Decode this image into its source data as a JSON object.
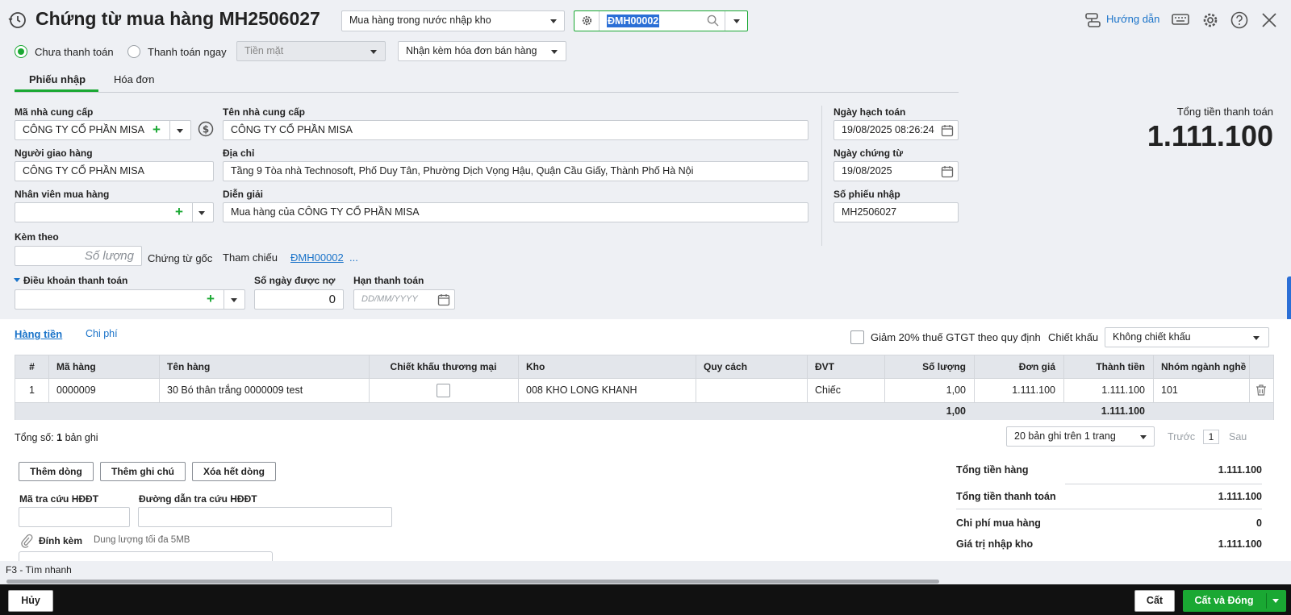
{
  "header": {
    "title": "Chứng từ mua hàng MH2506027",
    "type_select": "Mua hàng trong nước nhập kho",
    "ref_search": "ĐMH00002",
    "guide_label": "Hướng dẫn"
  },
  "payment": {
    "unpaid_label": "Chưa thanh toán",
    "paid_now_label": "Thanh toán ngay",
    "method_select": "Tiền mặt",
    "invoice_select": "Nhận kèm hóa đơn bán hàng"
  },
  "tabs": {
    "receipt": "Phiếu nhập",
    "invoice": "Hóa đơn"
  },
  "form": {
    "supplier_code_label": "Mã nhà cung cấp",
    "supplier_code": "CÔNG TY CỔ PHẦN MISA",
    "supplier_name_label": "Tên nhà cung cấp",
    "supplier_name": "CÔNG TY CỔ PHẦN MISA",
    "deliverer_label": "Người giao hàng",
    "deliverer": "CÔNG TY CỔ PHẦN MISA",
    "address_label": "Địa chỉ",
    "address": "Tầng 9 Tòa nhà Technosoft, Phố Duy Tân, Phường Dịch Vọng Hậu, Quận Cầu Giấy, Thành Phố Hà Nội",
    "buyer_label": "Nhân viên mua hàng",
    "buyer": "",
    "description_label": "Diễn giải",
    "description": "Mua hàng của CÔNG TY CỔ PHẦN MISA",
    "attach_label": "Kèm theo",
    "attach_placeholder": "Số lượng",
    "original_doc": "Chứng từ gốc",
    "reference_label": "Tham chiếu",
    "reference_link": "ĐMH00002",
    "reference_more": "...",
    "terms_label": "Điều khoản thanh toán",
    "credit_days_label": "Số ngày được nợ",
    "credit_days": "0",
    "due_date_label": "Hạn thanh toán",
    "due_date_placeholder": "DD/MM/YYYY",
    "posting_date_label": "Ngày hạch toán",
    "posting_date": "19/08/2025 08:26:24",
    "doc_date_label": "Ngày chứng từ",
    "doc_date": "19/08/2025",
    "receipt_no_label": "Số phiếu nhập",
    "receipt_no": "MH2506027",
    "total_label": "Tổng tiền thanh toán",
    "total": "1.111.100"
  },
  "detail_tabs": {
    "goods": "Hàng tiền",
    "cost": "Chi phí"
  },
  "discount": {
    "vat_reduce_label": "Giảm 20% thuế GTGT theo quy định",
    "label": "Chiết khấu",
    "select": "Không chiết khấu"
  },
  "table": {
    "headers": [
      "#",
      "Mã hàng",
      "Tên hàng",
      "Chiết khấu thương mại",
      "Kho",
      "Quy cách",
      "ĐVT",
      "Số lượng",
      "Đơn giá",
      "Thành tiền",
      "Nhóm ngành nghề"
    ],
    "rows": [
      {
        "no": "1",
        "code": "0000009",
        "name": "30 Bó thân trắng 0000009 test",
        "warehouse": "008 KHO LONG KHANH",
        "spec": "",
        "unit": "Chiếc",
        "qty": "1,00",
        "price": "1.111.100",
        "amount": "1.111.100",
        "group": "101"
      }
    ],
    "footer": {
      "qty": "1,00",
      "amount": "1.111.100"
    }
  },
  "paging": {
    "total_prefix": "Tổng số:",
    "total_count": "1",
    "total_suffix": "bản ghi",
    "per_page": "20 bản ghi trên 1 trang",
    "prev": "Trước",
    "page": "1",
    "next": "Sau"
  },
  "actions": {
    "add_row": "Thêm dòng",
    "add_note": "Thêm ghi chú",
    "delete_all": "Xóa hết dòng"
  },
  "einvoice": {
    "lookup_code_label": "Mã tra cứu HĐĐT",
    "lookup_url_label": "Đường dẫn tra cứu HĐĐT",
    "attach_label": "Đính kèm",
    "attach_hint": "Dung lượng tối đa 5MB"
  },
  "summary": {
    "goods_total_label": "Tổng tiền hàng",
    "goods_total": "1.111.100",
    "pay_total_label": "Tổng tiền thanh toán",
    "pay_total": "1.111.100",
    "purchase_cost_label": "Chi phí mua hàng",
    "purchase_cost": "0",
    "stock_value_label": "Giá trị nhập kho",
    "stock_value": "1.111.100"
  },
  "shortcut": "F3 - Tìm nhanh",
  "footer": {
    "cancel": "Hủy",
    "save": "Cất",
    "save_close": "Cất và Đóng"
  },
  "colors": {
    "accent": "#1aa833",
    "link": "#1a73c9",
    "footer_bg": "#111111"
  }
}
